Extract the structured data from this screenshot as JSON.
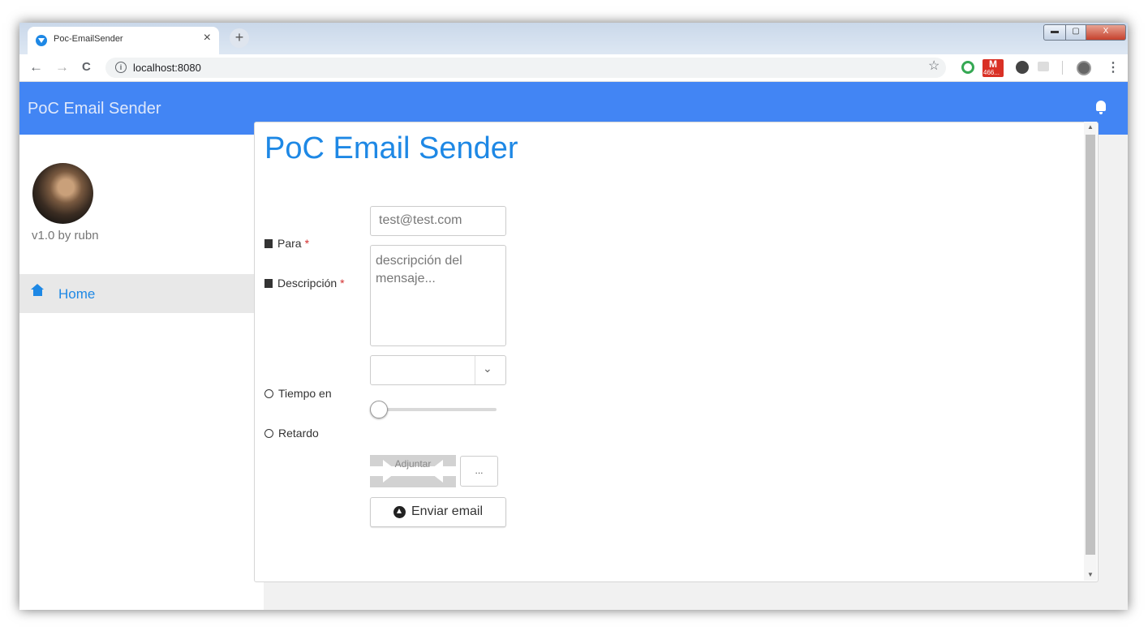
{
  "browser": {
    "tab_title": "Poc-EmailSender",
    "tab_close": "×",
    "new_tab": "+",
    "url": "localhost:8080",
    "back": "←",
    "forward": "→",
    "reload": "C",
    "bookmark_star": "☆",
    "gmail_badge": "466...",
    "menu": "⋮",
    "window_controls": {
      "minimize": "▬",
      "maximize": "▢",
      "close": "X"
    }
  },
  "app": {
    "title": "PoC Email Sender",
    "header_bg": "#4285f4",
    "accent": "#1e88e5"
  },
  "sidebar": {
    "version": "v1.0 by rubn",
    "items": [
      {
        "label": "Home",
        "icon": "home-icon",
        "active": true
      }
    ]
  },
  "form": {
    "title": "PoC Email Sender",
    "para": {
      "label": "Para",
      "required": "*",
      "icon": "inbox-icon",
      "placeholder": "test@test.com"
    },
    "descripcion": {
      "label": "Descripción",
      "required": "*",
      "icon": "file-icon",
      "placeholder": "descripción del mensaje..."
    },
    "tiempo": {
      "label": "Tiempo en",
      "icon": "timer-icon",
      "value": ""
    },
    "retardo": {
      "label": "Retardo",
      "icon": "refresh-icon",
      "value": 0
    },
    "attach": {
      "label": "Adjuntar",
      "browse": "..."
    },
    "submit": {
      "label": "Enviar email",
      "icon": "upload-icon"
    }
  }
}
